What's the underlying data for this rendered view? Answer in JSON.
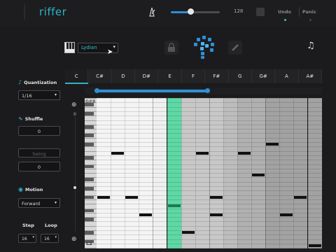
{
  "app": {
    "name": "riffer"
  },
  "toolbar": {
    "tempo": "128",
    "tempo_fraction": 0.4,
    "undo_label": "Undo",
    "panic_label": "Panic"
  },
  "scale": {
    "selected": "Lydian"
  },
  "sidebar": {
    "quantization": {
      "label": "Quantization",
      "value": "1/16"
    },
    "shuffle": {
      "label": "Shuffle",
      "value": "0"
    },
    "swing": {
      "label": "Swing",
      "value": "0"
    },
    "motion": {
      "label": "Motion",
      "value": "Forward"
    },
    "step": {
      "label": "Step",
      "value": "16"
    },
    "loop": {
      "label": "Loop",
      "value": "16"
    }
  },
  "keys": [
    "C",
    "C#",
    "D",
    "D#",
    "E",
    "F",
    "F#",
    "G",
    "G#",
    "A",
    "A#"
  ],
  "selected_key": "C",
  "grid": {
    "top_label": "G#8",
    "bottom_label": "C2",
    "octave_label": "8",
    "playhead_column": 5,
    "loop_start_column": 1,
    "loop_end_column": 9
  },
  "colors": {
    "accent": "#2fb3c7",
    "playhead": "#5ee0a8",
    "loop": "#2d8fd6"
  }
}
